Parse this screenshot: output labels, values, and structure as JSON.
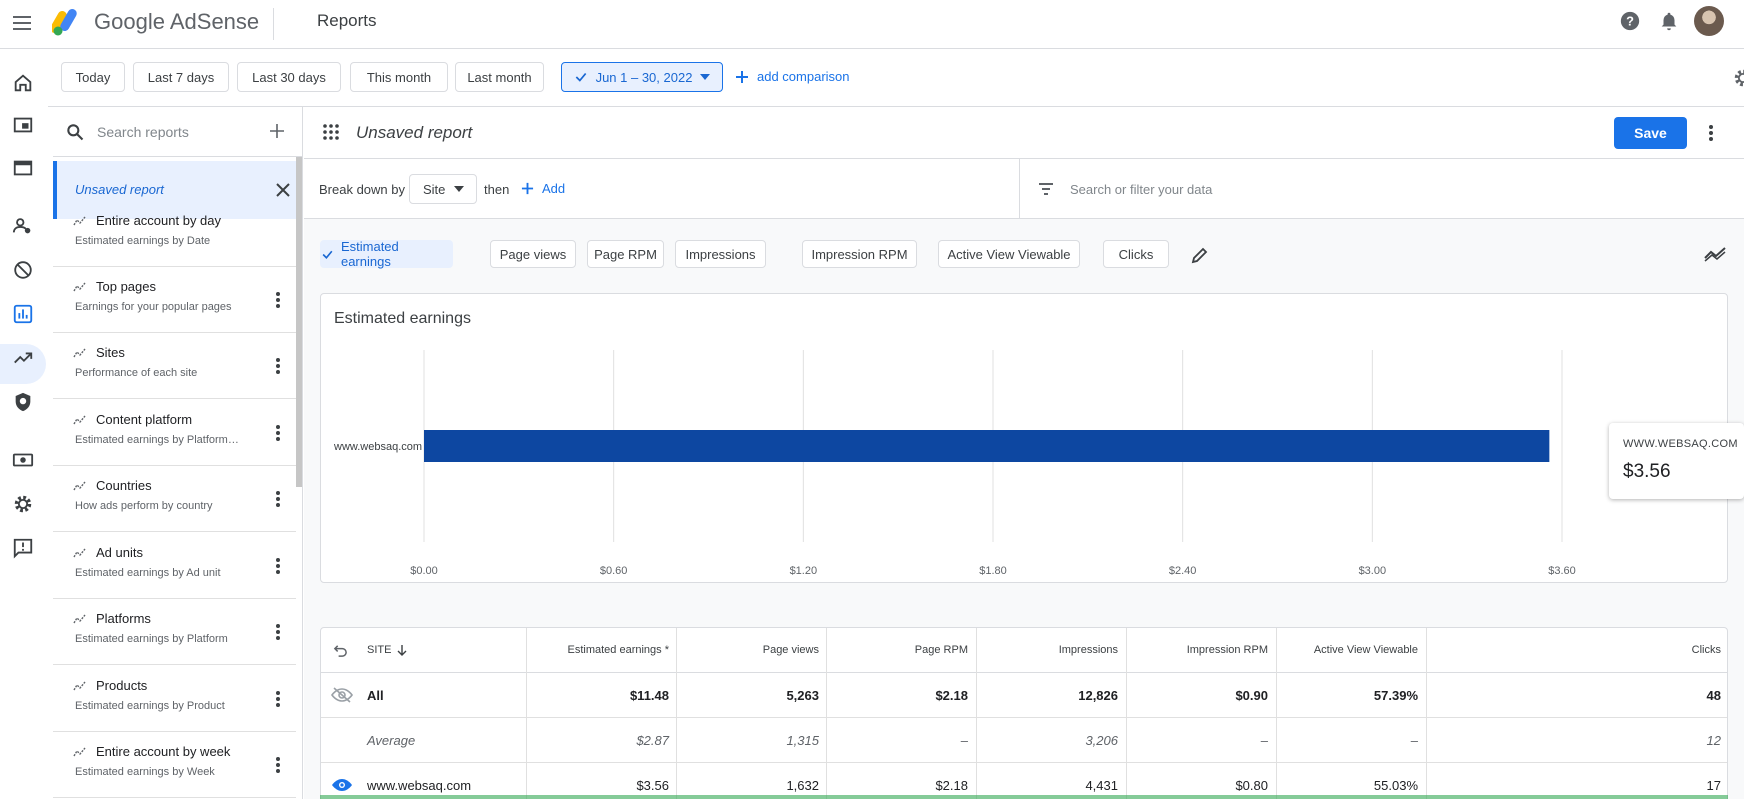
{
  "app": {
    "brand_google": "Google",
    "brand_product": "AdSense",
    "page_title": "Reports"
  },
  "colors": {
    "accent": "#1a73e8",
    "bar": "#0d47a1",
    "selected_bg": "#e8f0fe"
  },
  "date_chips": [
    {
      "label": "Today"
    },
    {
      "label": "Last 7 days"
    },
    {
      "label": "Last 30 days"
    },
    {
      "label": "This month"
    },
    {
      "label": "Last month"
    },
    {
      "label": "Jun 1 – 30, 2022",
      "selected": true
    }
  ],
  "add_comparison": "add comparison",
  "sidebar": {
    "search_placeholder": "Search reports",
    "unsaved_label": "Unsaved report",
    "items": [
      {
        "title": "Entire account by day",
        "subtitle": "Estimated earnings by Date"
      },
      {
        "title": "Top pages",
        "subtitle": "Earnings for your popular pages"
      },
      {
        "title": "Sites",
        "subtitle": "Performance of each site"
      },
      {
        "title": "Content platform",
        "subtitle": "Estimated earnings by Platform…"
      },
      {
        "title": "Countries",
        "subtitle": "How ads perform by country"
      },
      {
        "title": "Ad units",
        "subtitle": "Estimated earnings by Ad unit"
      },
      {
        "title": "Platforms",
        "subtitle": "Estimated earnings by Platform"
      },
      {
        "title": "Products",
        "subtitle": "Estimated earnings by Product"
      },
      {
        "title": "Entire account by week",
        "subtitle": "Estimated earnings by Week"
      }
    ]
  },
  "report": {
    "name": "Unsaved report",
    "save_label": "Save",
    "breakdown_label": "Break down by",
    "breakdown_value": "Site",
    "then_label": "then",
    "add_label": "Add",
    "filter_placeholder": "Search or filter your data",
    "metrics": [
      {
        "label": "Estimated earnings",
        "selected": true
      },
      {
        "label": "Page views"
      },
      {
        "label": "Page RPM"
      },
      {
        "label": "Impressions"
      },
      {
        "label": "Impression RPM"
      },
      {
        "label": "Active View Viewable"
      },
      {
        "label": "Clicks"
      }
    ]
  },
  "chart_data": {
    "type": "bar",
    "orientation": "horizontal",
    "title": "Estimated earnings",
    "categories": [
      "www.websaq.com"
    ],
    "values": [
      3.56
    ],
    "x_ticks": [
      "$0.00",
      "$0.60",
      "$1.20",
      "$1.80",
      "$2.40",
      "$3.00",
      "$3.60"
    ],
    "xlim": [
      0,
      3.6
    ],
    "grid": true
  },
  "tooltip": {
    "label": "WWW.WEBSAQ.COM",
    "value": "$3.56"
  },
  "table": {
    "headers": [
      "SITE",
      "Estimated earnings *",
      "Page views",
      "Page RPM",
      "Impressions",
      "Impression RPM",
      "Active View Viewable",
      "Clicks"
    ],
    "rows": [
      {
        "site": "All",
        "values": [
          "$11.48",
          "5,263",
          "$2.18",
          "12,826",
          "$0.90",
          "57.39%",
          "48"
        ]
      },
      {
        "site": "Average",
        "values": [
          "$2.87",
          "1,315",
          "–",
          "3,206",
          "–",
          "–",
          "12"
        ]
      },
      {
        "site": "www.websaq.com",
        "values": [
          "$3.56",
          "1,632",
          "$2.18",
          "4,431",
          "$0.80",
          "55.03%",
          "17"
        ]
      }
    ]
  }
}
